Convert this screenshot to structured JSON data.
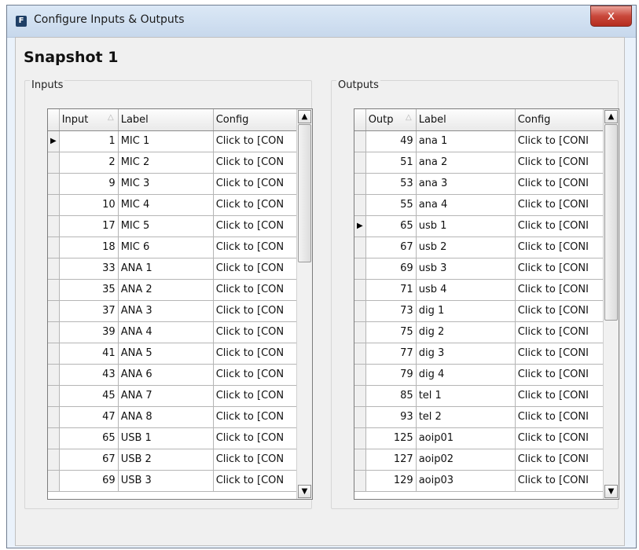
{
  "window": {
    "title": "Configure Inputs & Outputs",
    "app_icon": "F",
    "close_label": "x"
  },
  "snapshot_title": "Snapshot 1",
  "inputs": {
    "group_label": "Inputs",
    "columns": [
      "Input",
      "Label",
      "Config"
    ],
    "sort_indicator": "△",
    "rows": [
      {
        "num": "1",
        "label": "MIC 1",
        "config": "Click to [CON"
      },
      {
        "num": "2",
        "label": "MIC 2",
        "config": "Click to [CON"
      },
      {
        "num": "9",
        "label": "MIC 3",
        "config": "Click to [CON"
      },
      {
        "num": "10",
        "label": "MIC 4",
        "config": "Click to [CON"
      },
      {
        "num": "17",
        "label": "MIC 5",
        "config": "Click to [CON"
      },
      {
        "num": "18",
        "label": "MIC 6",
        "config": "Click to [CON"
      },
      {
        "num": "33",
        "label": "ANA 1",
        "config": "Click to [CON"
      },
      {
        "num": "35",
        "label": "ANA 2",
        "config": "Click to [CON"
      },
      {
        "num": "37",
        "label": "ANA 3",
        "config": "Click to [CON"
      },
      {
        "num": "39",
        "label": "ANA 4",
        "config": "Click to [CON"
      },
      {
        "num": "41",
        "label": "ANA 5",
        "config": "Click to [CON"
      },
      {
        "num": "43",
        "label": "ANA 6",
        "config": "Click to [CON"
      },
      {
        "num": "45",
        "label": "ANA 7",
        "config": "Click to [CON"
      },
      {
        "num": "47",
        "label": "ANA 8",
        "config": "Click to [CON"
      },
      {
        "num": "65",
        "label": "USB 1",
        "config": "Click to [CON"
      },
      {
        "num": "67",
        "label": "USB 2",
        "config": "Click to [CON"
      },
      {
        "num": "69",
        "label": "USB 3",
        "config": "Click to [CON"
      }
    ],
    "selected_row": 0
  },
  "outputs": {
    "group_label": "Outputs",
    "columns": [
      "Outp",
      "Label",
      "Config"
    ],
    "sort_indicator": "△",
    "rows": [
      {
        "num": "49",
        "label": "ana 1",
        "config": "Click to [CONI"
      },
      {
        "num": "51",
        "label": "ana 2",
        "config": "Click to [CONI"
      },
      {
        "num": "53",
        "label": "ana 3",
        "config": "Click to [CONI"
      },
      {
        "num": "55",
        "label": "ana 4",
        "config": "Click to [CONI"
      },
      {
        "num": "65",
        "label": "usb 1",
        "config": "Click to [CONI"
      },
      {
        "num": "67",
        "label": "usb 2",
        "config": "Click to [CONI"
      },
      {
        "num": "69",
        "label": "usb 3",
        "config": "Click to [CONI"
      },
      {
        "num": "71",
        "label": "usb 4",
        "config": "Click to [CONI"
      },
      {
        "num": "73",
        "label": "dig 1",
        "config": "Click to [CONI"
      },
      {
        "num": "75",
        "label": "dig 2",
        "config": "Click to [CONI"
      },
      {
        "num": "77",
        "label": "dig 3",
        "config": "Click to [CONI"
      },
      {
        "num": "79",
        "label": "dig 4",
        "config": "Click to [CONI"
      },
      {
        "num": "85",
        "label": "tel 1",
        "config": "Click to [CONI"
      },
      {
        "num": "93",
        "label": "tel 2",
        "config": "Click to [CONI"
      },
      {
        "num": "125",
        "label": "aoip01",
        "config": "Click to [CONI"
      },
      {
        "num": "127",
        "label": "aoip02",
        "config": "Click to [CONI"
      },
      {
        "num": "129",
        "label": "aoip03",
        "config": "Click to [CONI"
      }
    ],
    "selected_row": 4
  },
  "icons": {
    "row_pointer": "▶",
    "scroll_up": "▲",
    "scroll_down": "▼"
  }
}
